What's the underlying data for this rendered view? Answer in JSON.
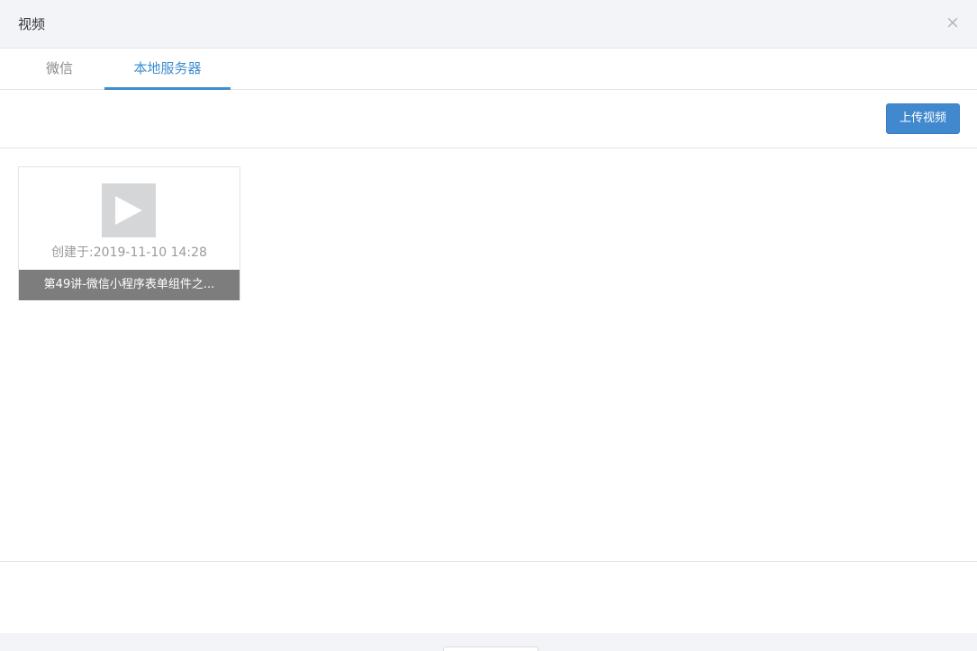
{
  "dialog": {
    "title": "视频",
    "close_symbol": "×"
  },
  "tabs": [
    {
      "label": "微信",
      "active": false
    },
    {
      "label": "本地服务器",
      "active": true
    }
  ],
  "toolbar": {
    "upload_label": "上传视频"
  },
  "videos": [
    {
      "thumbnail_icon": "play-icon",
      "created_label": "创建于:2019-11-10 14:28",
      "title": "第49讲-微信小程序表单组件之..."
    }
  ],
  "colors": {
    "accent": "#4189cf",
    "header_bg": "#f3f4f8",
    "card_title_bg": "#7d7d7d"
  }
}
